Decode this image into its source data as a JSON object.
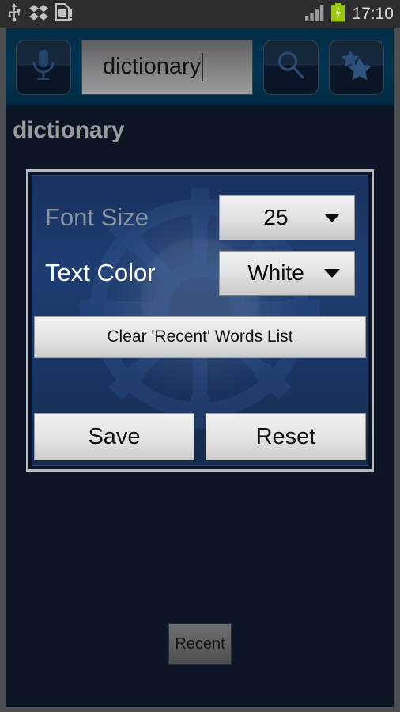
{
  "statusbar": {
    "icons": [
      "usb-icon",
      "dropbox-icon",
      "sim-card-icon",
      "signal-bars-icon",
      "battery-charging-icon"
    ],
    "time": "17:10",
    "battery_color": "#99cc00"
  },
  "toolbar": {
    "voice_button": "mic-icon",
    "search_button": "magnifier-icon",
    "favorites_button": "star-icon",
    "search_value": "dictionary",
    "search_placeholder": "dictionary"
  },
  "header": {
    "title": "dictionary"
  },
  "settings": {
    "font_size": {
      "label": "Font Size",
      "value": "25"
    },
    "text_color": {
      "label": "Text Color",
      "value": "White"
    },
    "clear_button": "Clear 'Recent' Words List",
    "save_button": "Save",
    "reset_button": "Reset"
  },
  "bottom": {
    "recent_button": "Recent"
  },
  "colors": {
    "toolbar_bg": "#002d46",
    "panel_bg": "#1d3c70",
    "app_bg": "#0d1626",
    "title_text": "#9b9b9b",
    "label_muted": "#8b94a1",
    "label_active": "#ffffff",
    "status_bg": "#2b2d2f",
    "panel_border": "#b6bbc2"
  }
}
